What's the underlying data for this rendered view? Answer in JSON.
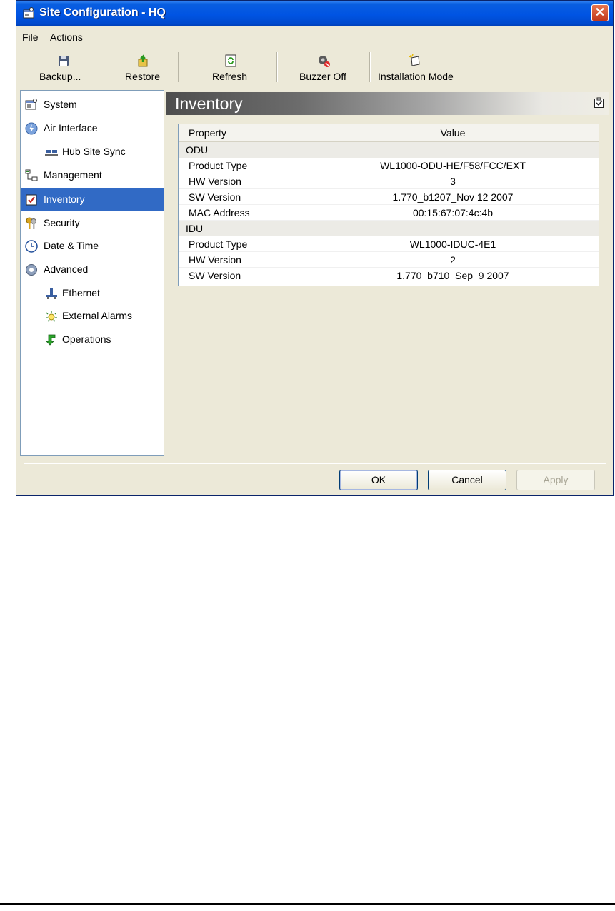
{
  "window": {
    "title": "Site Configuration - HQ",
    "close_glyph": "✕"
  },
  "menu": {
    "items": [
      {
        "label": "File"
      },
      {
        "label": "Actions"
      }
    ]
  },
  "toolbar": {
    "backup_label": "Backup...",
    "restore_label": "Restore",
    "refresh_label": "Refresh",
    "buzzer_label": "Buzzer Off",
    "installation_label": "Installation Mode"
  },
  "tree": {
    "items": [
      {
        "label": "System",
        "icon": "system-icon"
      },
      {
        "label": "Air Interface",
        "icon": "air-interface-icon"
      },
      {
        "label": "Hub Site Sync",
        "icon": "hub-site-sync-icon"
      },
      {
        "label": "Management",
        "icon": "management-icon"
      },
      {
        "label": "Inventory",
        "icon": "inventory-icon",
        "selected": true
      },
      {
        "label": "Security",
        "icon": "security-keys-icon"
      },
      {
        "label": "Date & Time",
        "icon": "clock-icon"
      },
      {
        "label": "Advanced",
        "icon": "gear-icon"
      },
      {
        "label": "Ethernet",
        "icon": "ethernet-icon"
      },
      {
        "label": "External Alarms",
        "icon": "alarm-icon"
      },
      {
        "label": "Operations",
        "icon": "green-arrow-icon"
      }
    ]
  },
  "content": {
    "title": "Inventory",
    "table": {
      "col_property": "Property",
      "col_value": "Value",
      "groups": [
        {
          "name": "ODU",
          "rows": [
            {
              "property": "Product Type",
              "value": "WL1000-ODU-HE/F58/FCC/EXT"
            },
            {
              "property": "HW Version",
              "value": "3"
            },
            {
              "property": "SW Version",
              "value": "1.770_b1207_Nov 12 2007"
            },
            {
              "property": "MAC Address",
              "value": "00:15:67:07:4c:4b"
            }
          ]
        },
        {
          "name": "IDU",
          "rows": [
            {
              "property": "Product Type",
              "value": "WL1000-IDUC-4E1"
            },
            {
              "property": "HW Version",
              "value": "2"
            },
            {
              "property": "SW Version",
              "value": "1.770_b710_Sep  9 2007"
            }
          ]
        }
      ]
    }
  },
  "buttons": {
    "ok": "OK",
    "cancel": "Cancel",
    "apply": "Apply"
  },
  "colors": {
    "title_bar": "#0054e3",
    "selection": "#316ac5",
    "dialog_bg": "#ece9d8"
  }
}
